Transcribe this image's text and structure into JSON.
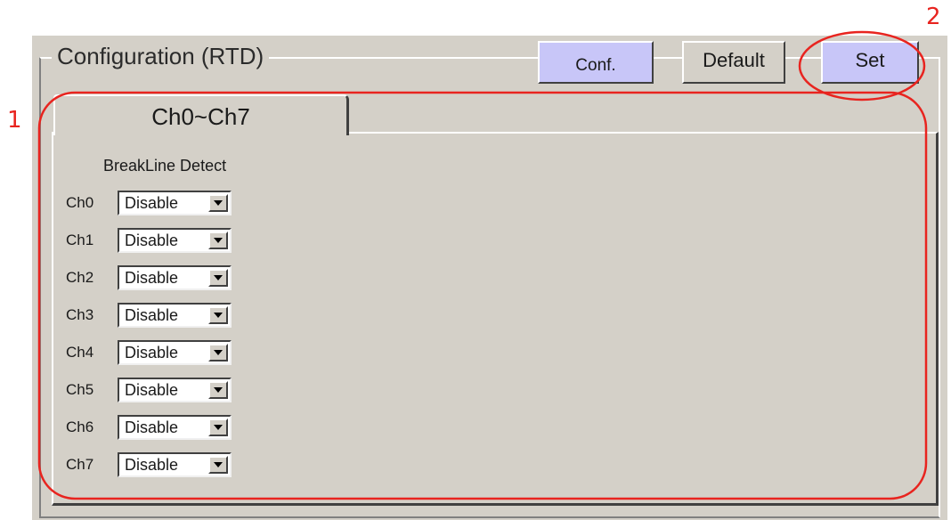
{
  "group": {
    "title": "Configuration (RTD)"
  },
  "toolbar": {
    "conf_label": "Conf.",
    "default_label": "Default",
    "set_label": "Set"
  },
  "tab": {
    "label": "Ch0~Ch7"
  },
  "table": {
    "column_header": "BreakLine Detect",
    "rows": [
      {
        "channel": "Ch0",
        "value": "Disable"
      },
      {
        "channel": "Ch1",
        "value": "Disable"
      },
      {
        "channel": "Ch2",
        "value": "Disable"
      },
      {
        "channel": "Ch3",
        "value": "Disable"
      },
      {
        "channel": "Ch4",
        "value": "Disable"
      },
      {
        "channel": "Ch5",
        "value": "Disable"
      },
      {
        "channel": "Ch6",
        "value": "Disable"
      },
      {
        "channel": "Ch7",
        "value": "Disable"
      }
    ]
  },
  "annotations": {
    "label_1": "1",
    "label_2": "2",
    "color": "#e8241f"
  },
  "icons": {
    "dropdown": "chevron-down-icon"
  }
}
